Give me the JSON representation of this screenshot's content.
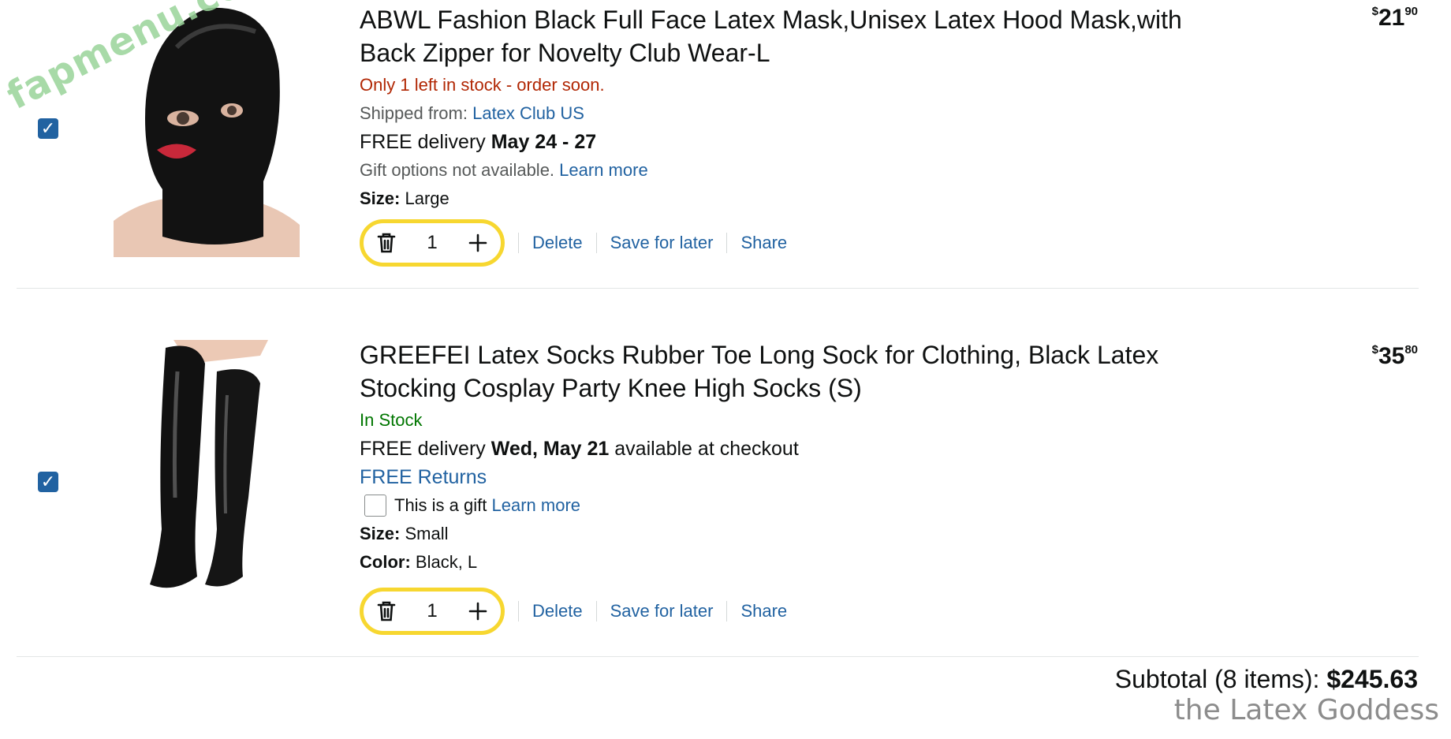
{
  "cart": {
    "items": [
      {
        "title": "ABWL Fashion Black Full Face Latex Mask,Unisex Latex Hood Mask,with Back Zipper for Novelty Club Wear-L",
        "stock": "Only 1 left in stock - order soon.",
        "shipped_label": "Shipped from:",
        "shipped_value": "Latex Club US",
        "delivery_prefix": "FREE delivery",
        "delivery_date": "May 24 - 27",
        "gift_text": "Gift options not available.",
        "gift_link": "Learn more",
        "size_label": "Size:",
        "size_value": "Large",
        "quantity": "1",
        "price_dollars": "21",
        "price_cents": "90",
        "price_symbol": "$",
        "checked": true
      },
      {
        "title": "GREEFEI Latex Socks Rubber Toe Long Sock for Clothing, Black Latex Stocking Cosplay Party Knee High Socks (S)",
        "stock": "In Stock",
        "delivery_prefix": "FREE delivery",
        "delivery_date": "Wed, May 21",
        "delivery_suffix": "available at checkout",
        "returns": "FREE Returns",
        "gift_text": "This is a gift",
        "gift_link": "Learn more",
        "size_label": "Size:",
        "size_value": "Small",
        "color_label": "Color:",
        "color_value": "Black, L",
        "quantity": "1",
        "price_dollars": "35",
        "price_cents": "80",
        "price_symbol": "$",
        "checked": true
      }
    ],
    "actions": {
      "delete": "Delete",
      "save_for_later": "Save for later",
      "share": "Share"
    },
    "subtotal_label": "Subtotal (8 items):",
    "subtotal_value": "$245.63"
  },
  "watermarks": {
    "logo": "fapmenu.com",
    "caption": "the Latex Goddess"
  },
  "colors": {
    "link": "#2162a1",
    "stepper_border": "#f7d730",
    "stock_low": "#b12704",
    "stock_in": "#007600",
    "checkbox": "#2162a1"
  },
  "icons": {
    "trash": "trash-icon",
    "plus": "plus-icon",
    "check": "checkmark-icon"
  }
}
